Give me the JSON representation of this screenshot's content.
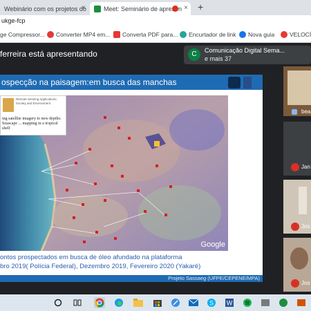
{
  "browser": {
    "tabs": [
      {
        "title": "Webinário com os projetos do E...",
        "close": "×"
      },
      {
        "title": "Meet: Seminário de apresen",
        "close": "×"
      }
    ],
    "new_tab": "+",
    "url": "ukge-fcp",
    "bookmarks": [
      {
        "label": "ge Compressor...",
        "color": "#9aa0a6"
      },
      {
        "label": "Converter MP4 em...",
        "color": "#e53935"
      },
      {
        "label": "Converta PDF para...",
        "color": "#e53935"
      },
      {
        "label": "Encurtador de link",
        "color": "#26a69a"
      },
      {
        "label": "Nova guia",
        "color": "#1a73e8"
      },
      {
        "label": "VELOCÍM",
        "color": "#e53935"
      }
    ]
  },
  "meet": {
    "presenting_text": "ferreira está apresentando",
    "meeting_avatar_letter": "C",
    "meeting_name": "Comunicação Digital Sema...",
    "meeting_more": "e mais 37"
  },
  "slide": {
    "title": "ospecção na paisagem:em busca das manchas",
    "inset_title": "Remote Sensing Applications: Society and Environment",
    "inset_headline": "ing satellite imagery to new depths: Seascape ... mapping in a tropical shelf",
    "map_watermark": "Google",
    "caption_line1": "ontos prospectados em busca de óleo afundado na plataforma",
    "caption_line2": "bro 2019( Polícia Federal),  Dezembro 2019, Fevereiro 2020 (Yakaré)",
    "footer": "Projeto Sassaeg (UFPE/CEPENE/MPA)"
  },
  "participants": [
    {
      "name": "bea"
    },
    {
      "name": "Jan"
    },
    {
      "name": "Jos"
    },
    {
      "name": "Jos"
    }
  ],
  "taskbar": {
    "icons": [
      "search-icon",
      "task-view-icon",
      "chrome-icon",
      "edge-icon",
      "file-explorer-icon",
      "store-icon",
      "pen-icon",
      "mail-icon",
      "skype-icon",
      "word-icon",
      "spotify-icon",
      "app-icon"
    ]
  }
}
